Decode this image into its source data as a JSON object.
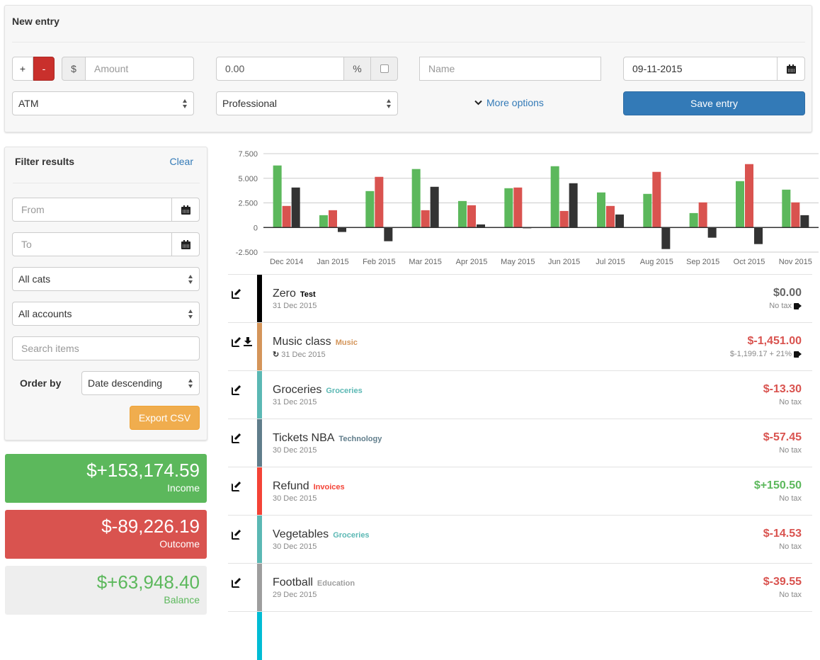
{
  "new_entry": {
    "title": "New entry",
    "plus_label": "+",
    "minus_label": "-",
    "currency_symbol": "$",
    "amount_placeholder": "Amount",
    "tax_value": "0.00",
    "percent_symbol": "%",
    "name_placeholder": "Name",
    "date_value": "09-11-2015",
    "account_selected": "ATM",
    "category_selected": "Professional",
    "more_options_label": "More options",
    "save_label": "Save entry"
  },
  "filter": {
    "title": "Filter results",
    "clear_label": "Clear",
    "from_placeholder": "From",
    "to_placeholder": "To",
    "cats_selected": "All cats",
    "accounts_selected": "All accounts",
    "search_placeholder": "Search items",
    "order_by_label": "Order by",
    "order_selected": "Date descending",
    "export_label": "Export CSV"
  },
  "summary": {
    "income": {
      "value": "$+153,174.59",
      "label": "Income"
    },
    "outcome": {
      "value": "$-89,226.19",
      "label": "Outcome"
    },
    "balance": {
      "value": "$+63,948.40",
      "label": "Balance"
    }
  },
  "colors": {
    "income": "#5cb85c",
    "outcome": "#d9534f",
    "balance": "#333333",
    "primary": "#337ab7",
    "warning": "#f0ad4e",
    "minus_active": "#c9302c"
  },
  "chart_data": {
    "type": "bar",
    "title": "",
    "xlabel": "",
    "ylabel": "",
    "ylim": [
      -2500,
      7500
    ],
    "yticks": [
      "7.500",
      "5.000",
      "2.500",
      "0",
      "-2.500"
    ],
    "ytick_values": [
      7500,
      5000,
      2500,
      0,
      -2500
    ],
    "grid": true,
    "legend": "none",
    "categories": [
      "Dec 2014",
      "Jan 2015",
      "Feb 2015",
      "Mar 2015",
      "Apr 2015",
      "May 2015",
      "Jun 2015",
      "Jul 2015",
      "Aug 2015",
      "Sep 2015",
      "Oct 2015",
      "Nov 2015"
    ],
    "series": [
      {
        "name": "Income",
        "color": "#5cb85c",
        "values": [
          6300,
          1250,
          3700,
          5940,
          2690,
          3990,
          6225,
          3560,
          3415,
          1465,
          4710,
          3845
        ]
      },
      {
        "name": "Outcome",
        "color": "#d9534f",
        "values": [
          2190,
          1755,
          5145,
          1755,
          2260,
          4060,
          1680,
          2190,
          5650,
          2550,
          6440,
          2550
        ]
      },
      {
        "name": "Balance",
        "color": "#333333",
        "values": [
          4060,
          -457,
          -1395,
          4135,
          310,
          -80,
          4495,
          1320,
          -2190,
          -1035,
          -1685,
          1250
        ]
      }
    ]
  },
  "entries": [
    {
      "name": "Zero",
      "category": "Test",
      "cat_color": "#000000",
      "date": "31 Dec 2015",
      "amount": "$0.00",
      "amount_color": "#666666",
      "tax": "No tax",
      "tag": true,
      "download": false,
      "recurring": false
    },
    {
      "name": "Music class",
      "category": "Music",
      "cat_color": "#d4955a",
      "date": "31 Dec 2015",
      "amount": "$-1,451.00",
      "amount_color": "#d9534f",
      "tax": "$-1,199.17 + 21%",
      "tag": true,
      "download": true,
      "recurring": true
    },
    {
      "name": "Groceries",
      "category": "Groceries",
      "cat_color": "#5bb8b4",
      "date": "31 Dec 2015",
      "amount": "$-13.30",
      "amount_color": "#d9534f",
      "tax": "No tax",
      "tag": false,
      "download": false,
      "recurring": false
    },
    {
      "name": "Tickets NBA",
      "category": "Technology",
      "cat_color": "#607d8b",
      "date": "30 Dec 2015",
      "amount": "$-57.45",
      "amount_color": "#d9534f",
      "tax": "No tax",
      "tag": false,
      "download": false,
      "recurring": false
    },
    {
      "name": "Refund",
      "category": "Invoices",
      "cat_color": "#f44336",
      "date": "30 Dec 2015",
      "amount": "$+150.50",
      "amount_color": "#5cb85c",
      "tax": "No tax",
      "tag": false,
      "download": false,
      "recurring": false
    },
    {
      "name": "Vegetables",
      "category": "Groceries",
      "cat_color": "#5bb8b4",
      "date": "30 Dec 2015",
      "amount": "$-14.53",
      "amount_color": "#d9534f",
      "tax": "No tax",
      "tag": false,
      "download": false,
      "recurring": false
    },
    {
      "name": "Football",
      "category": "Education",
      "cat_color": "#9e9e9e",
      "date": "29 Dec 2015",
      "amount": "$-39.55",
      "amount_color": "#d9534f",
      "tax": "No tax",
      "tag": false,
      "download": false,
      "recurring": false
    },
    {
      "name": "",
      "category": "",
      "cat_color": "#00bcd4",
      "date": "",
      "amount": "",
      "amount_color": "#d9534f",
      "tax": "",
      "tag": false,
      "download": false,
      "recurring": false
    }
  ]
}
